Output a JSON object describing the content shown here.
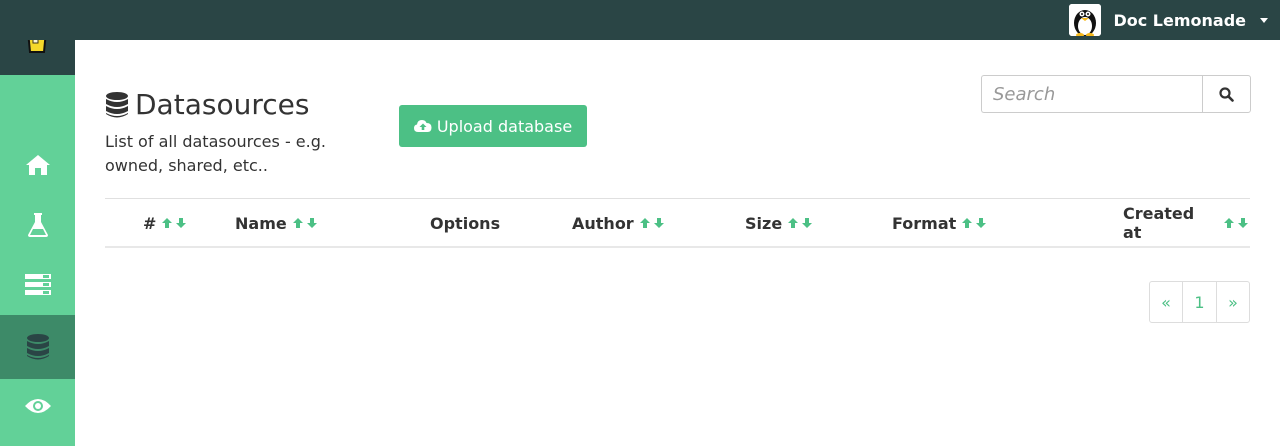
{
  "app": {
    "accent_color": "#4cc085",
    "sidebar_color": "#62d198",
    "topbar_color": "#2a4545"
  },
  "user": {
    "name": "Doc Lemonade",
    "avatar_icon": "penguin-avatar"
  },
  "sidebar": {
    "logo_icon": "lemonade-glass-icon",
    "items": [
      {
        "icon": "home-icon",
        "active": false
      },
      {
        "icon": "flask-icon",
        "active": false
      },
      {
        "icon": "list-icon",
        "active": false
      },
      {
        "icon": "database-icon",
        "active": true
      },
      {
        "icon": "eye-icon",
        "active": false
      }
    ]
  },
  "page": {
    "title": "Datasources",
    "subtitle": "List of all datasources - e.g. owned, shared, etc..",
    "upload_label": "Upload database"
  },
  "search": {
    "placeholder": "Search",
    "value": ""
  },
  "table": {
    "columns": [
      {
        "label": "#",
        "sortable": true
      },
      {
        "label": "Name",
        "sortable": true
      },
      {
        "label": "Options",
        "sortable": false
      },
      {
        "label": "Author",
        "sortable": true
      },
      {
        "label": "Size",
        "sortable": true
      },
      {
        "label": "Format",
        "sortable": true
      },
      {
        "label": "Created at",
        "sortable": true
      }
    ],
    "rows": []
  },
  "pagination": {
    "prev": "«",
    "current": "1",
    "next": "»"
  }
}
